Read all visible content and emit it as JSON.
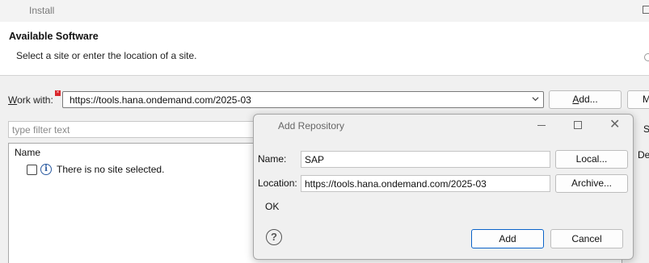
{
  "window": {
    "title": "Install"
  },
  "header": {
    "title": "Available Software",
    "description": "Select a site or enter the location of a site."
  },
  "work_with": {
    "label_prefix": "W",
    "label_rest": "ork with:",
    "value": "https://tools.hana.ondemand.com/2025-03",
    "add_button_prefix": "A",
    "add_button_rest": "dd...",
    "edge_button": "M"
  },
  "filter": {
    "placeholder": "type filter text",
    "edge_button_s": "S",
    "edge_button_d": "De"
  },
  "tree": {
    "column_header": "Name",
    "rows": [
      {
        "label": "There is no site selected."
      }
    ]
  },
  "dialog": {
    "title": "Add Repository",
    "name_label": "Name:",
    "name_value": "SAP",
    "location_label": "Location:",
    "location_value": "https://tools.hana.ondemand.com/2025-03",
    "local_button": "Local...",
    "archive_button": "Archive...",
    "status_message": "OK",
    "help_symbol": "?",
    "add_button": "Add",
    "cancel_button": "Cancel"
  },
  "icons": {
    "app": "eclipse-icon",
    "error": "error-decoration-icon",
    "info": "info-icon",
    "help": "help-icon",
    "dropdown": "chevron-down-icon"
  },
  "colors": {
    "accent": "#0b63c9",
    "error": "#d9262b"
  }
}
